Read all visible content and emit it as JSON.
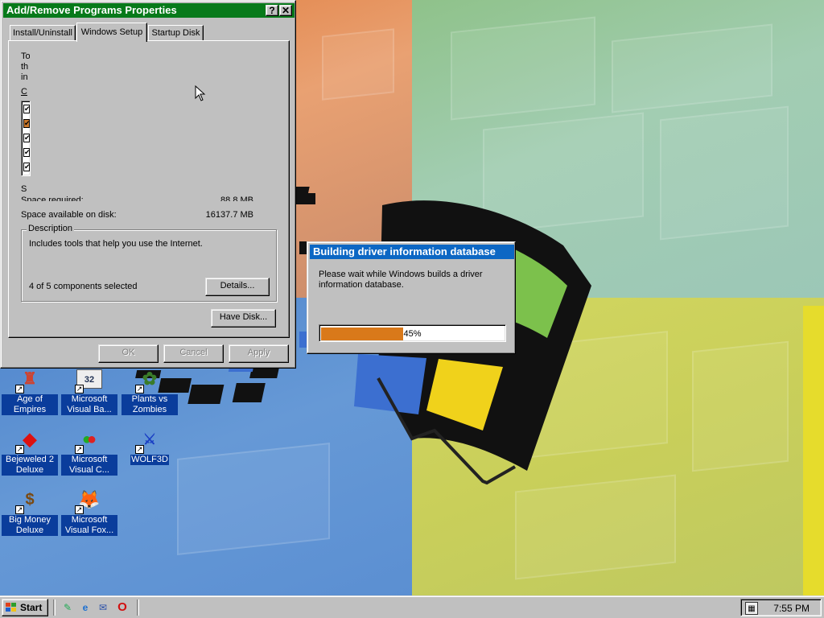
{
  "colors": {
    "titlebar_active": "#077a1a",
    "progress_titlebar": "#0c67c4",
    "progress_fill": "#d9791a",
    "icon_label_bg": "#0a3d9c",
    "face": "#c0c0c0"
  },
  "add_remove_window": {
    "title": "Add/Remove Programs Properties",
    "help_label": "?",
    "close_label": "✕",
    "tabs": [
      {
        "label": "Install/Uninstall",
        "active": false
      },
      {
        "label": "Windows Setup",
        "active": true
      },
      {
        "label": "Startup Disk",
        "active": false
      }
    ],
    "intro_fragments": [
      "To",
      "th",
      "in"
    ],
    "components_label_fragment": "C",
    "component_checks": [
      {
        "checked": true,
        "selected": false
      },
      {
        "checked": true,
        "selected": true
      },
      {
        "checked": true,
        "selected": false
      },
      {
        "checked": true,
        "selected": false
      },
      {
        "checked": true,
        "selected": false
      }
    ],
    "space_used_label_fragment": "S",
    "space_required_label": "Space required:",
    "space_required_value": "88.8 MB",
    "space_available_label": "Space available on disk:",
    "space_available_value": "16137.7 MB",
    "description_label": "Description",
    "description_text": "Includes tools that help you use the Internet.",
    "components_selected": "4 of 5 components selected",
    "details_button": "Details...",
    "have_disk_button": "Have Disk...",
    "ok_button": "OK",
    "cancel_button": "Cancel",
    "apply_button": "Apply"
  },
  "progress_dialog": {
    "title": "Building driver information database",
    "message": "Please wait while Windows builds a driver information database.",
    "percent": 45,
    "percent_label": "45%"
  },
  "desktop_icons": [
    {
      "label": "Age of Empires",
      "icon": "age-of-empires-icon"
    },
    {
      "label": "Microsoft Visual Ba...",
      "icon": "visual-basic-icon"
    },
    {
      "label": "Plants vs Zombies",
      "icon": "plants-vs-zombies-icon"
    },
    {
      "label": "Bejeweled 2 Deluxe",
      "icon": "bejeweled-icon"
    },
    {
      "label": "Microsoft Visual C...",
      "icon": "visual-cpp-icon"
    },
    {
      "label": "WOLF3D",
      "icon": "wolf3d-icon"
    },
    {
      "label": "Big Money Deluxe",
      "icon": "big-money-icon"
    },
    {
      "label": "Microsoft Visual Fox...",
      "icon": "visual-foxpro-icon"
    }
  ],
  "taskbar": {
    "start_label": "Start",
    "quick_launch": [
      "show-desktop-icon",
      "internet-explorer-icon",
      "outlook-express-icon",
      "opera-icon"
    ],
    "tray_icon": "scheduler-icon",
    "clock": "7:55 PM"
  }
}
